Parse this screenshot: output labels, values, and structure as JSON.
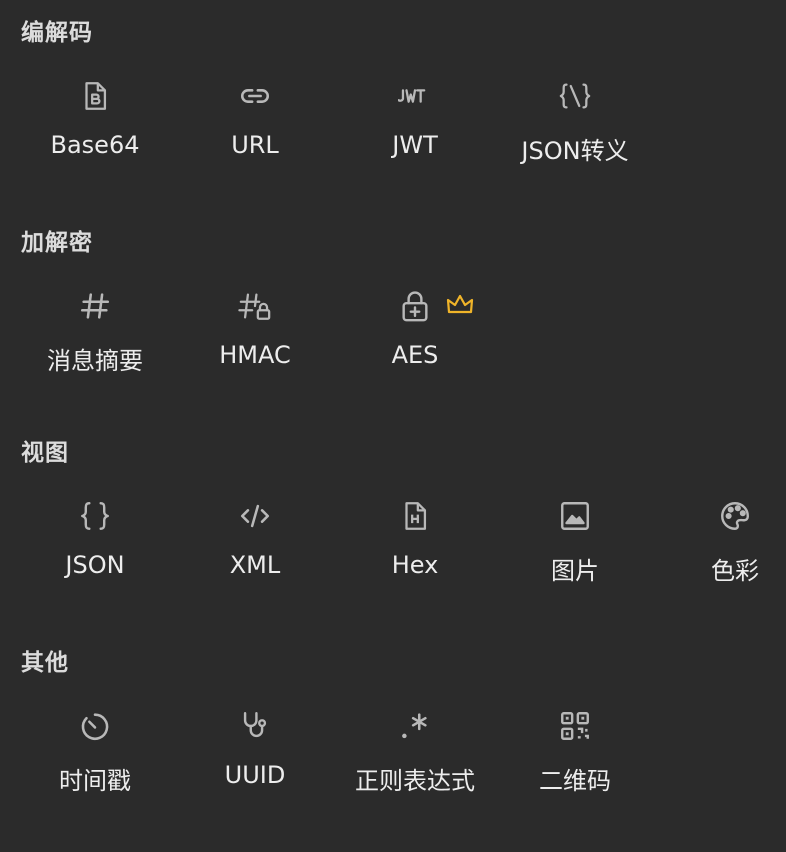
{
  "sections": [
    {
      "title": "编解码",
      "tools": [
        {
          "label": "Base64",
          "icon": "file-b-icon"
        },
        {
          "label": "URL",
          "icon": "link-icon"
        },
        {
          "label": "JWT",
          "icon": "jwt-icon"
        },
        {
          "label": "JSON转义",
          "icon": "json-escape-icon"
        }
      ]
    },
    {
      "title": "加解密",
      "tools": [
        {
          "label": "消息摘要",
          "icon": "hash-icon"
        },
        {
          "label": "HMAC",
          "icon": "hash-lock-icon"
        },
        {
          "label": "AES",
          "icon": "lock-plus-icon",
          "badge": "crown-icon"
        }
      ]
    },
    {
      "title": "视图",
      "tools": [
        {
          "label": "JSON",
          "icon": "braces-icon"
        },
        {
          "label": "XML",
          "icon": "code-icon"
        },
        {
          "label": "Hex",
          "icon": "file-h-icon"
        },
        {
          "label": "图片",
          "icon": "image-icon"
        },
        {
          "label": "色彩",
          "icon": "palette-icon"
        }
      ]
    },
    {
      "title": "其他",
      "tools": [
        {
          "label": "时间戳",
          "icon": "timer-icon"
        },
        {
          "label": "UUID",
          "icon": "stethoscope-icon"
        },
        {
          "label": "正则表达式",
          "icon": "regex-icon"
        },
        {
          "label": "二维码",
          "icon": "qr-code-icon"
        }
      ]
    }
  ],
  "colors": {
    "background": "#2b2b2b",
    "icon": "#b8b8b8",
    "crown": "#f0b429"
  }
}
